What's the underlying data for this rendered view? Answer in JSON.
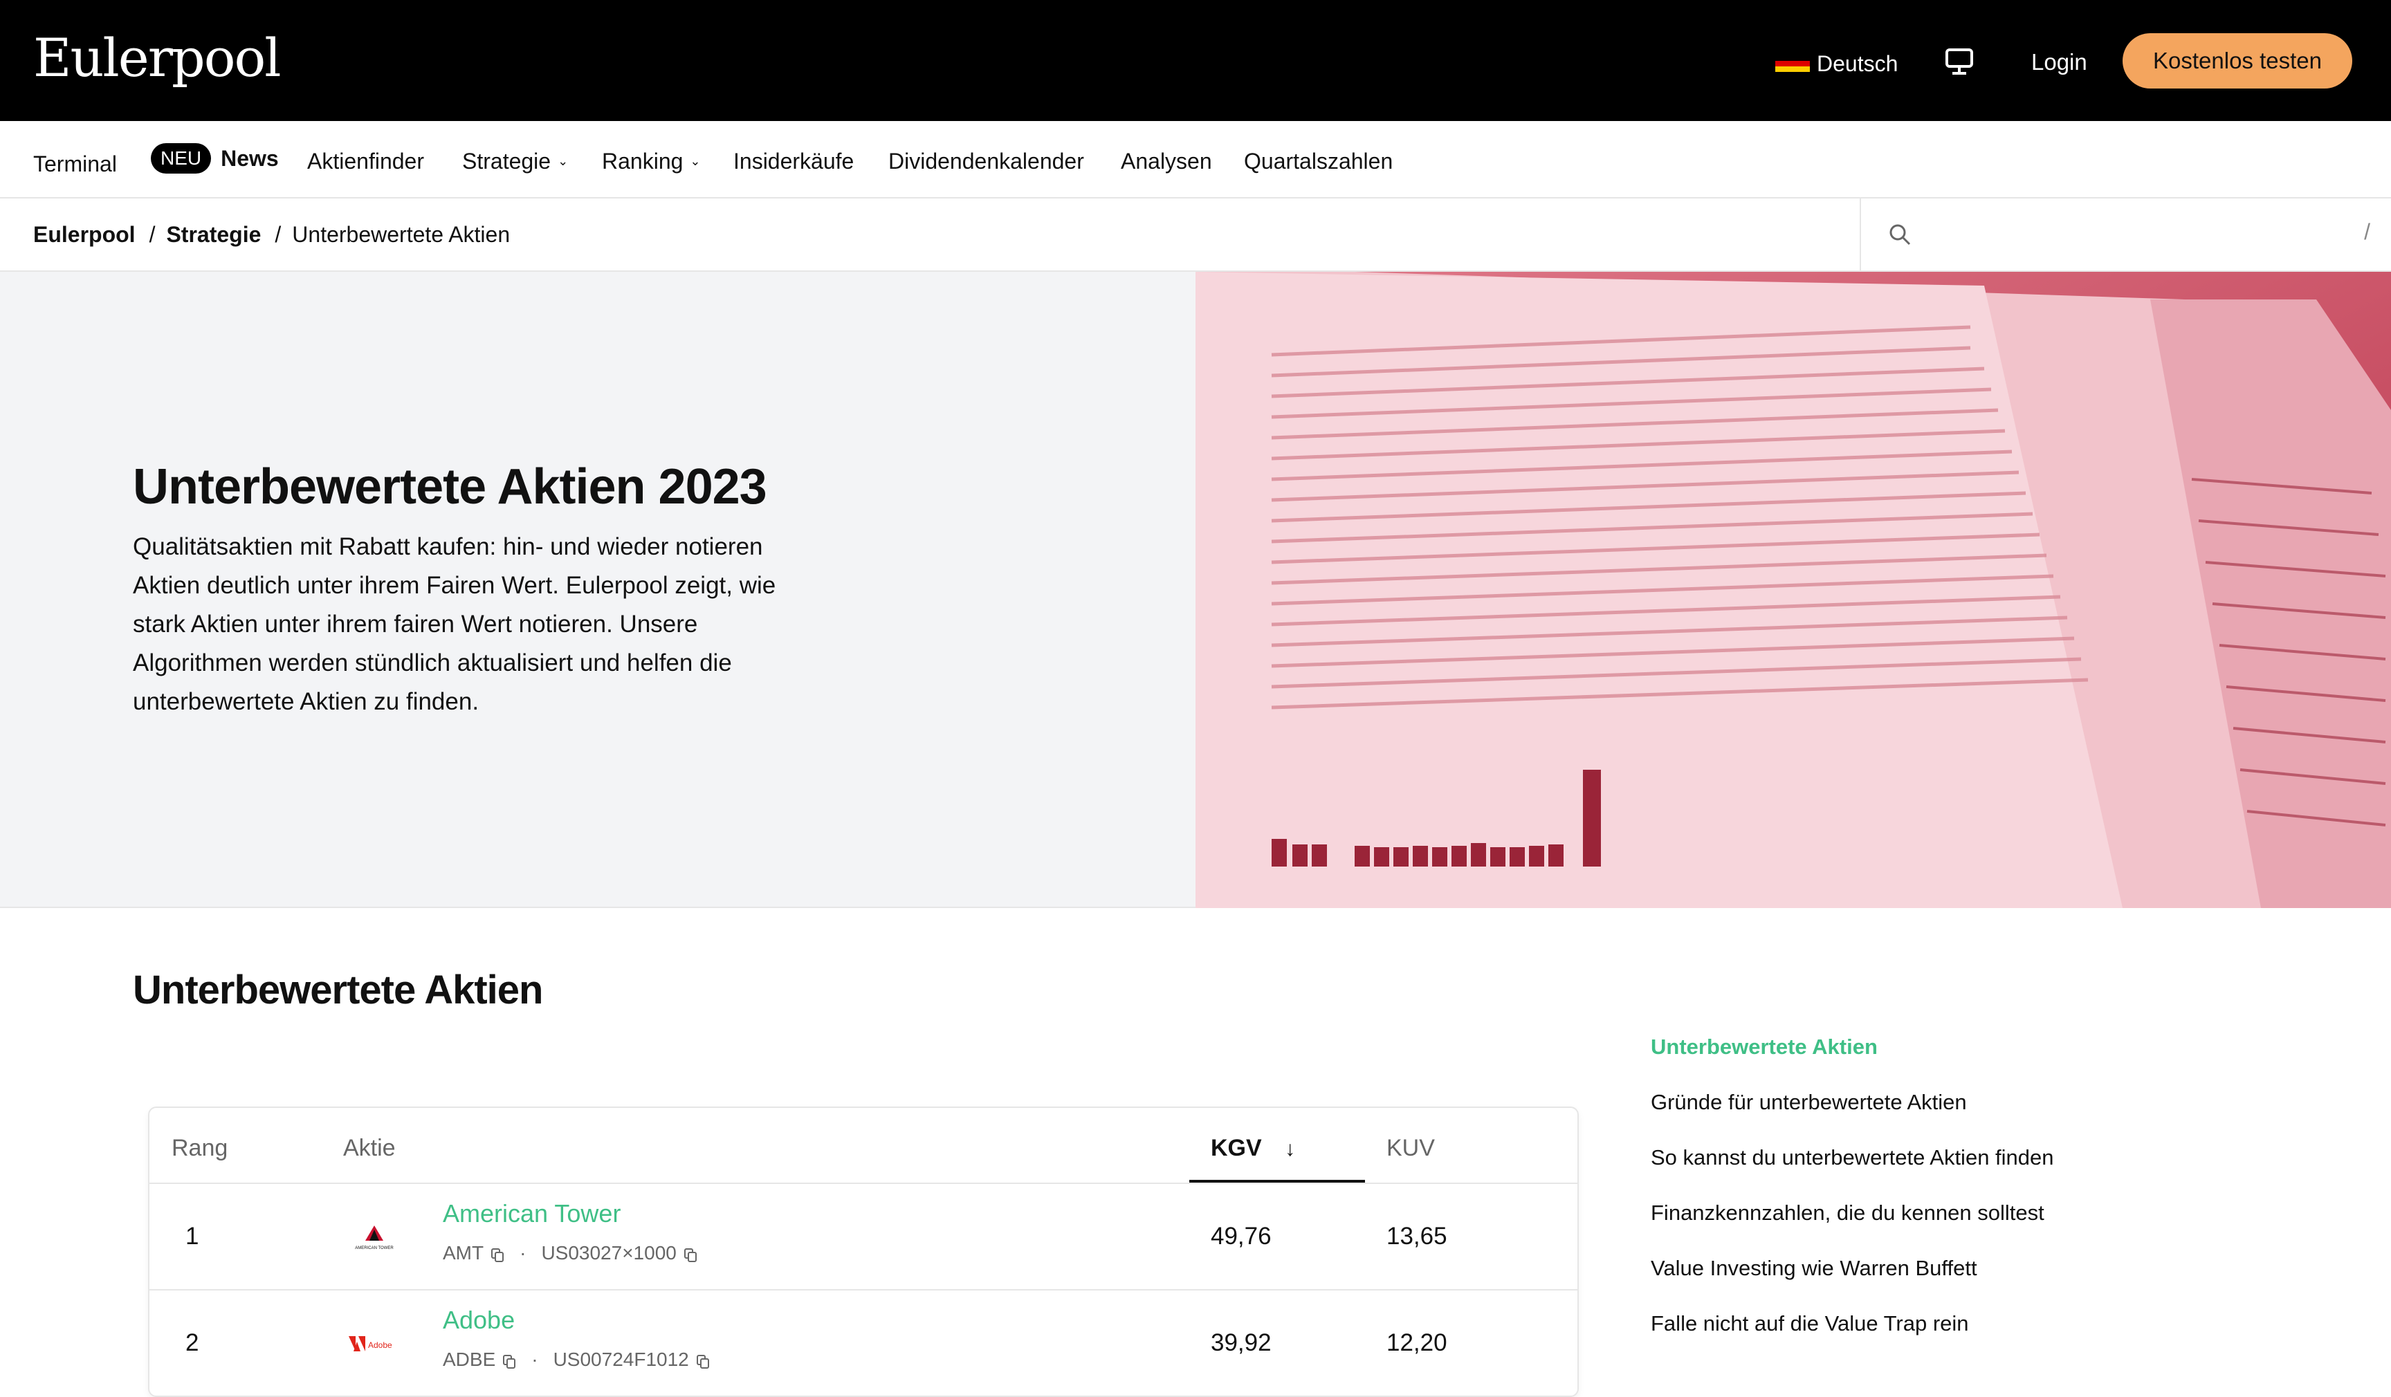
{
  "header": {
    "logo": "Eulerpool",
    "language": "Deutsch",
    "login": "Login",
    "cta": "Kostenlos testen",
    "accent_color": "#f4a55e"
  },
  "nav": {
    "items": [
      {
        "label": "Terminal"
      },
      {
        "badge": "NEU",
        "label": "News"
      },
      {
        "label": "Aktienfinder"
      },
      {
        "label": "Strategie",
        "dropdown": true
      },
      {
        "label": "Ranking",
        "dropdown": true
      },
      {
        "label": "Insiderkäufe"
      },
      {
        "label": "Dividendenkalender"
      },
      {
        "label": "Analysen"
      },
      {
        "label": "Quartalszahlen"
      }
    ]
  },
  "breadcrumb": {
    "items": [
      "Eulerpool",
      "Strategie",
      "Unterbewertete Aktien"
    ]
  },
  "search": {
    "shortcut": "/",
    "icon": "search-icon"
  },
  "hero": {
    "title": "Unterbewertete Aktien 2023",
    "text": "Qualitätsaktien mit Rabatt kaufen: hin- und wieder notieren Aktien deutlich unter ihrem Fairen Wert. Eulerpool zeigt, wie stark Aktien unter ihrem fairen Wert notieren. Unsere Algorithmen werden stündlich aktualisiert und helfen die unterbewertete Aktien zu finden."
  },
  "main": {
    "section_title": "Unterbewertete Aktien",
    "table": {
      "columns": {
        "rank": "Rang",
        "stock": "Aktie",
        "kgv": "KGV",
        "kuv": "KUV"
      },
      "sorted_by": "KGV",
      "rows": [
        {
          "rank": "1",
          "name": "American Tower",
          "ticker": "AMT",
          "isin": "US03027×1000",
          "kgv": "49,76",
          "kuv": "13,65",
          "logo_text": "AMERICAN TOWER"
        },
        {
          "rank": "2",
          "name": "Adobe",
          "ticker": "ADBE",
          "isin": "US00724F1012",
          "kgv": "39,92",
          "kuv": "12,20",
          "logo_text": "Adobe"
        }
      ]
    }
  },
  "toc": {
    "items": [
      "Unterbewertete Aktien",
      "Gründe für unterbewertete Aktien",
      "So kannst du unterbewertete Aktien finden",
      "Finanzkennzahlen, die du kennen solltest",
      "Value Investing wie Warren Buffett",
      "Falle nicht auf die Value Trap rein"
    ],
    "active_color": "#3fbf86"
  }
}
